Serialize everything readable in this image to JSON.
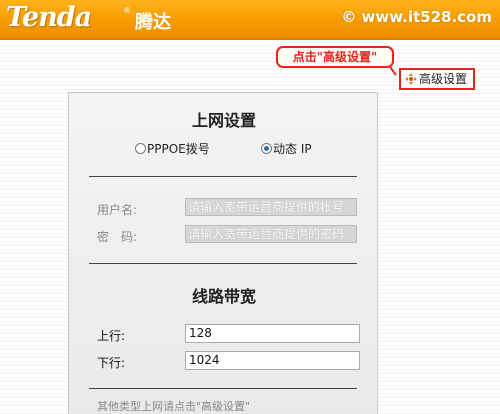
{
  "header": {
    "logo_text": "Tenda",
    "logo_reg": "®",
    "logo_cn": "腾达",
    "watermark": "© www.it528.com"
  },
  "callout": {
    "text": "点击\"高级设置\""
  },
  "advanced_button": {
    "label": "高级设置",
    "icon": "gear-arrows-icon"
  },
  "panel": {
    "title": "上网设置",
    "connection_types": [
      {
        "label": "PPPOE拨号",
        "selected": false
      },
      {
        "label": "动态 IP",
        "selected": true
      }
    ],
    "username": {
      "label": "用户名:",
      "placeholder": "请输入宽带运营商提供的帐号"
    },
    "password": {
      "label": "密　码:",
      "placeholder": "请输入宽带运营商提供的密码"
    },
    "bandwidth_title": "线路带宽",
    "upload": {
      "label": "上行:",
      "value": "128"
    },
    "download": {
      "label": "下行:",
      "value": "1024"
    },
    "note": "其他类型上网请点击\"高级设置\""
  },
  "colors": {
    "header": "#f59a00",
    "highlight": "#e8231a",
    "radio_dot": "#3366aa"
  }
}
